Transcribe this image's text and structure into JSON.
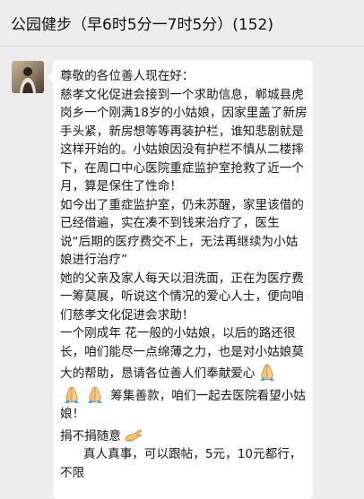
{
  "header": {
    "title": "公园健步（早6时5分一7时5分）(152)"
  },
  "message": {
    "sender_avatar_icon": "contact-avatar-photo",
    "paragraphs": [
      "尊敬的各位善人现在好：",
      "慈孝文化促进会接到一个求助信息，郸城县虎岗乡一个刚满18岁的小姑娘，因家里盖了新房手头紧，新房想等等再装护栏，谁知悲剧就是这样开始的。小姑娘因没有护栏不慎从二楼摔下，在周口中心医院重症监护室抢救了近一个月，算是保住了性命！",
      "如今出了重症监护室，仍未苏醒，家里该借的已经借遍，实在凑不到钱来治疗了，医生说“后期的医疗费交不上，无法再继续为小姑娘进行治疗”",
      "她的父亲及家人每天以泪洗面，正在为医疗费一筹莫展，听说这个情况的爱心人士，便向咱们慈孝文化促进会求助！",
      "一个刚成年 花一般的小姑娘，以后的路还很长，咱们能尽一点绵薄之力，也是对小姑娘莫大的帮助，恳请各位善人们奉献爱心",
      "筹集善款，咱们一起去医院看望小姑娘！",
      "捐不捐随意",
      "真人真事，可以跟帖，5元，10元都行，不限"
    ],
    "icons": {
      "pray": "folded-hands-icon",
      "clap": "clapping-hands-icon"
    }
  }
}
